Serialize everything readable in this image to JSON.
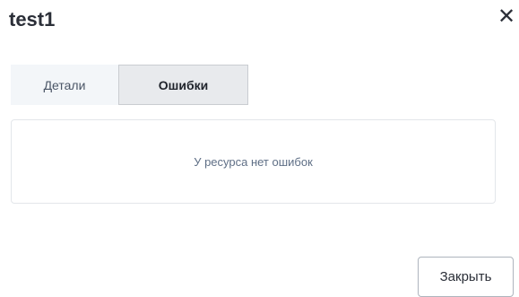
{
  "dialog": {
    "title": "test1",
    "close_icon": "close-icon",
    "close_glyph": "✕"
  },
  "tabs": [
    {
      "label": "Детали",
      "active": false
    },
    {
      "label": "Ошибки",
      "active": true
    }
  ],
  "errors_panel": {
    "empty_message": "У ресурса нет ошибок"
  },
  "footer": {
    "close_label": "Закрыть"
  }
}
